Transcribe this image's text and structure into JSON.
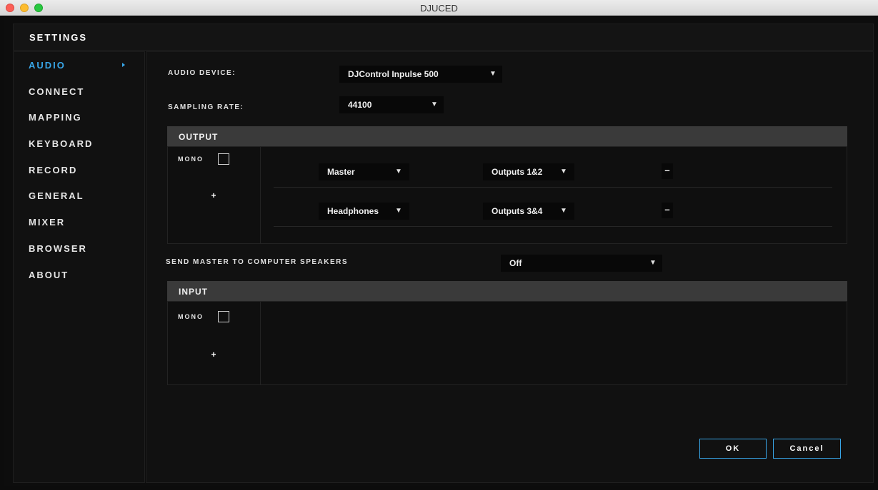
{
  "window": {
    "title": "DJUCED"
  },
  "header": {
    "title": "SETTINGS"
  },
  "sidebar": {
    "items": [
      {
        "label": "AUDIO",
        "active": true
      },
      {
        "label": "CONNECT"
      },
      {
        "label": "MAPPING"
      },
      {
        "label": "KEYBOARD"
      },
      {
        "label": "RECORD"
      },
      {
        "label": "GENERAL"
      },
      {
        "label": "MIXER"
      },
      {
        "label": "BROWSER"
      },
      {
        "label": "ABOUT"
      }
    ]
  },
  "audio": {
    "device_label": "AUDIO DEVICE:",
    "device_value": "DJControl Inpulse 500",
    "sampling_label": "SAMPLING RATE:",
    "sampling_value": "44100",
    "output": {
      "title": "OUTPUT",
      "mono_label": "MONO",
      "add_label": "+",
      "rows": [
        {
          "channel": "Master",
          "outputs": "Outputs 1&2",
          "remove_label": "–"
        },
        {
          "channel": "Headphones",
          "outputs": "Outputs 3&4",
          "remove_label": "–"
        }
      ]
    },
    "send_master_label": "SEND MASTER TO COMPUTER SPEAKERS",
    "send_master_value": "Off",
    "input": {
      "title": "INPUT",
      "mono_label": "MONO",
      "add_label": "+"
    }
  },
  "footer": {
    "ok_label": "OK",
    "cancel_label": "Cancel"
  },
  "icons": {
    "dropdown_arrow": "▼"
  },
  "colors": {
    "accent": "#38a6e8",
    "background": "#0d0d0d",
    "section_bar": "#3a3a3a"
  }
}
